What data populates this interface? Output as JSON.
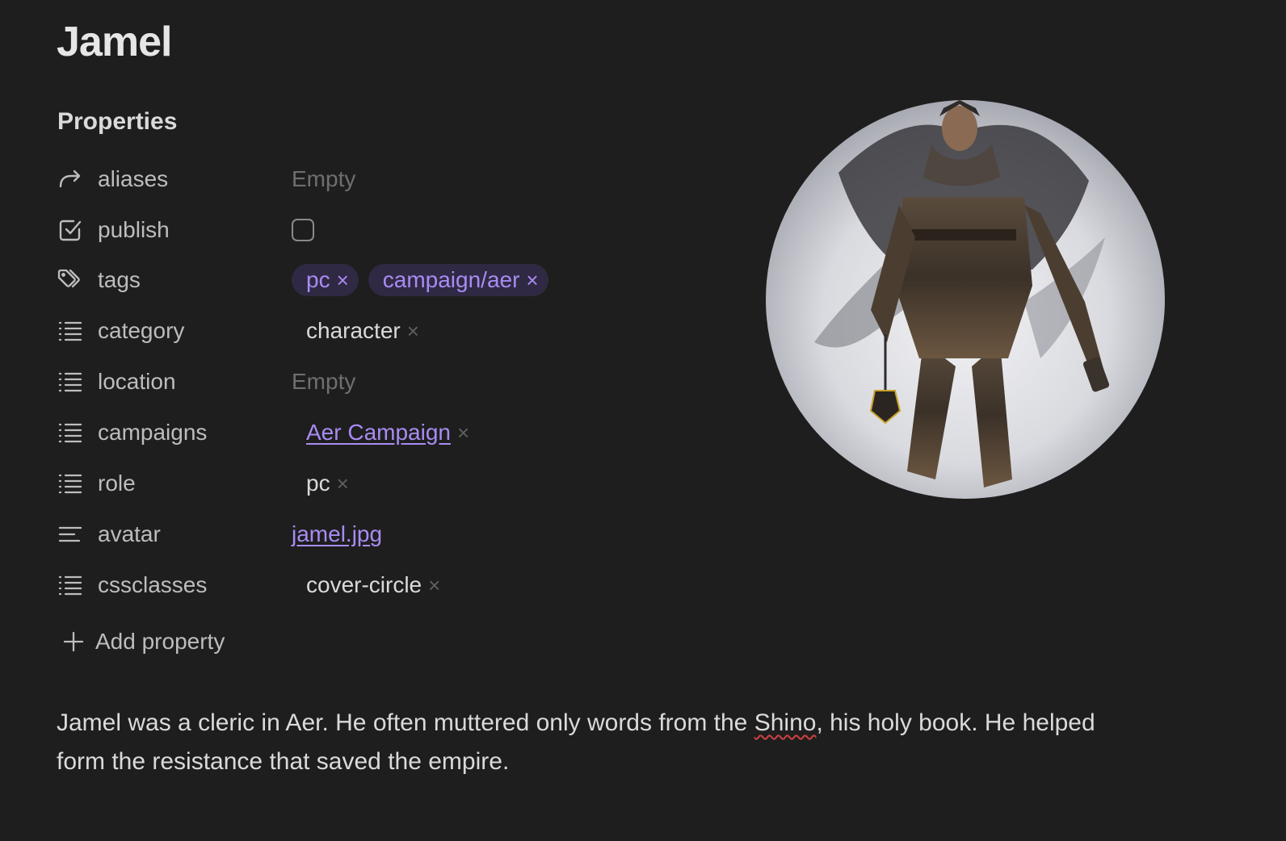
{
  "note": {
    "title": "Jamel",
    "properties_heading": "Properties",
    "properties": {
      "aliases": {
        "name": "aliases",
        "value": "Empty"
      },
      "publish": {
        "name": "publish",
        "checked": false
      },
      "tags": {
        "name": "tags",
        "values": [
          {
            "label": "pc",
            "remove": "×"
          },
          {
            "label": "campaign/aer",
            "remove": "×"
          }
        ]
      },
      "category": {
        "name": "category",
        "values": [
          {
            "label": "character",
            "remove": "×"
          }
        ]
      },
      "location": {
        "name": "location",
        "value": "Empty"
      },
      "campaigns": {
        "name": "campaigns",
        "values": [
          {
            "label": "Aer Campaign",
            "remove": "×"
          }
        ]
      },
      "role": {
        "name": "role",
        "values": [
          {
            "label": "pc",
            "remove": "×"
          }
        ]
      },
      "avatar": {
        "name": "avatar",
        "value": "jamel.jpg"
      },
      "cssclasses": {
        "name": "cssclasses",
        "values": [
          {
            "label": "cover-circle",
            "remove": "×"
          }
        ]
      }
    },
    "add_property_label": "Add property",
    "body": {
      "part1": "Jamel was a cleric in Aer. He often muttered only words from the ",
      "misspelled": "Shino",
      "part2": ", his holy book. He helped form the resistance that saved the empire."
    }
  },
  "colors": {
    "background": "#1e1e1e",
    "accent": "#a98bf3",
    "tag_background": "#2f2943",
    "text": "#dadada",
    "muted": "#6f6f6f"
  },
  "icons": {
    "aliases": "arrow-forward-icon",
    "publish": "checkbox-checked-icon",
    "tags": "tags-icon",
    "list": "list-icon",
    "text": "text-lines-icon",
    "add": "plus-icon"
  }
}
